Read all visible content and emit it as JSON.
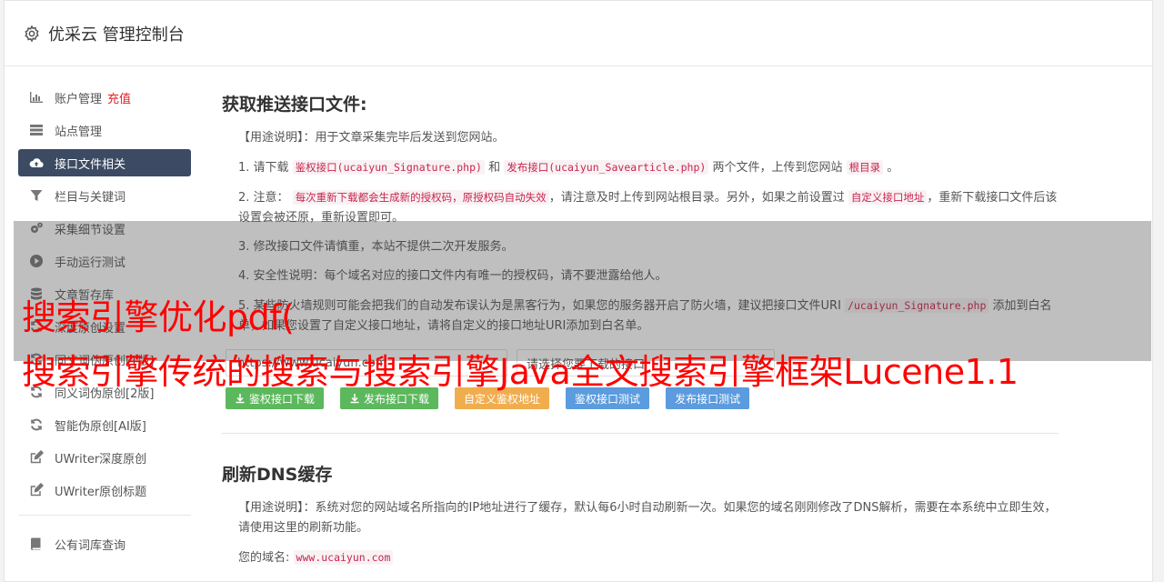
{
  "header": {
    "title": "优采云 管理控制台"
  },
  "sidebar": {
    "items": [
      {
        "label": "账户管理",
        "extra": "充值",
        "icon": "bar-chart-icon"
      },
      {
        "label": "站点管理",
        "icon": "server-icon"
      },
      {
        "label": "接口文件相关",
        "icon": "cloud-upload-icon",
        "active": true
      },
      {
        "label": "栏目与关键词",
        "icon": "filter-icon"
      },
      {
        "label": "采集细节设置",
        "icon": "gears-icon"
      },
      {
        "label": "手动运行测试",
        "icon": "play-circle-icon"
      },
      {
        "label": "文章暂存库",
        "icon": "database-icon"
      },
      {
        "label": "深度原创设置",
        "icon": "refresh-icon"
      },
      {
        "label": "同义词伪原创[1版]",
        "icon": "refresh-icon"
      },
      {
        "label": "同义词伪原创[2版]",
        "icon": "refresh-icon"
      },
      {
        "label": "智能伪原创[AI版]",
        "icon": "refresh-icon"
      },
      {
        "label": "UWriter深度原创",
        "icon": "edit-icon"
      },
      {
        "label": "UWriter原创标题",
        "icon": "edit-icon"
      }
    ],
    "bottom_items": [
      {
        "label": "公有词库查询",
        "icon": "book-icon"
      }
    ]
  },
  "push": {
    "title": "获取推送接口文件:",
    "usage_label": "【用途说明】",
    "usage_text": "：用于文章采集完毕后发送到您网站。",
    "step1": {
      "prefix": "1. 请下载",
      "file1": "鉴权接口(ucaiyun_Signature.php)",
      "and": "和",
      "file2": "发布接口(ucaiyun_Savearticle.php)",
      "mid": "两个文件，上传到您网站",
      "dir": "根目录",
      "end": "。"
    },
    "step2": {
      "prefix": "2. 注意：",
      "warn": "每次重新下载都会生成新的授权码，原授权码自动失效",
      "mid": "，请注意及时上传到网站根目录。另外，如果之前设置过",
      "custom": "自定义接口地址",
      "end": "，重新下载接口文件后该设置会被还原，重新设置即可。"
    },
    "step3": "3. 修改接口文件请慎重，本站不提供二次开发服务。",
    "step4": "4. 安全性说明：每个域名对应的接口文件内有唯一的授权码，请不要泄露给他人。",
    "step5": {
      "prefix": "5. 某些防火墙规则可能会把我们的自动发布误认为是黑客行为，如果您的服务器开启了防火墙，建议把接口文件URI",
      "uri": "/ucaiyun_Signature.php",
      "end": "添加到白名单，如果您设置了自定义接口地址，请将自定义的接口地址URI添加到白名单。"
    },
    "url_value": "https://www.ucaiyun.com",
    "select_value": "请选择您要下载的接口",
    "buttons": {
      "sig_download": "鉴权接口下载",
      "pub_download": "发布接口下载",
      "custom_sig": "自定义鉴权地址",
      "sig_test": "鉴权接口测试",
      "pub_test": "发布接口测试"
    }
  },
  "dns": {
    "title": "刷新DNS缓存",
    "usage_label": "【用途说明】",
    "usage_text": "：系统对您的网站域名所指向的IP地址进行了缓存，默认每6小时自动刷新一次。如果您的域名刚刚修改了DNS解析，需要在本系统中立即生效，请使用这里的刷新功能。",
    "domain_label": "您的域名:",
    "domain_value": "www.ucaiyun.com"
  },
  "overlay": {
    "line1": "搜索引擎优化pdf(",
    "line2": "搜索引擎传统的搜索与搜索引擎Java全文搜索引擎框架Lucene1.1"
  },
  "colors": {
    "active_nav": "#3c4a63",
    "green_button": "#5cb85c",
    "orange_button": "#f0ad4e",
    "blue_button": "#5bc0de",
    "highlight_red": "#e61e1e",
    "code_red": "#c7254e",
    "overlay_text": "#ff0000"
  }
}
